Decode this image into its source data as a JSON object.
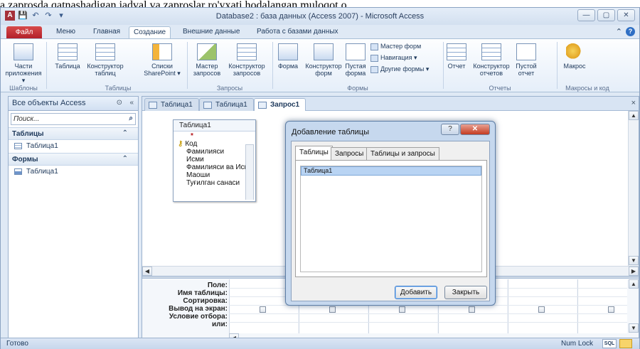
{
  "caption": "a zaprosda qatnashadigan jadval va zaproslar ro'yxati hodalangan muloqot o",
  "window": {
    "title": "Database2 : база данных (Access 2007) - Microsoft Access",
    "controls": [
      "—",
      "▢",
      "✕"
    ]
  },
  "qat": {
    "app_icon": "A",
    "save": "💾",
    "undo": "↶",
    "redo": "↷",
    "dropdown": "▾"
  },
  "ribbon_tabs": {
    "file": "Файл",
    "items": [
      "Меню",
      "Главная",
      "Создание",
      "Внешние данные",
      "Работа с базами данных"
    ]
  },
  "ribbon": {
    "templates": {
      "parts": "Части\nприложения ▾",
      "label": "Шаблоны"
    },
    "tables": {
      "table": "Таблица",
      "constructor": "Конструктор\nтаблиц",
      "lists": "Списки\nSharePoint ▾",
      "label": "Таблицы"
    },
    "queries": {
      "wizard": "Мастер\nзапросов",
      "constructor": "Конструктор\nзапросов",
      "label": "Запросы"
    },
    "forms": {
      "form": "Форма",
      "constructor": "Конструктор\nформ",
      "empty": "Пустая\nформа",
      "wizard": "Мастер форм",
      "navigation": "Навигация ▾",
      "other": "Другие формы ▾",
      "label": "Формы"
    },
    "reports": {
      "report": "Отчет",
      "constructor": "Конструктор\nотчетов",
      "empty": "Пустой\nотчет",
      "label": "Отчеты"
    },
    "macros": {
      "macro": "Макрос",
      "label": "Макросы и код"
    }
  },
  "nav": {
    "header": "Все объекты Access",
    "header_btn1": "⊙",
    "header_btn2": "«",
    "search_placeholder": "Поиск...",
    "search_icon": "⌕",
    "groups": [
      {
        "title": "Таблицы",
        "chevron": "⌃",
        "items": [
          "Таблица1"
        ]
      },
      {
        "title": "Формы",
        "chevron": "⌃",
        "items": [
          "Таблица1"
        ]
      }
    ]
  },
  "doc_tabs": [
    "Таблица1",
    "Таблица1",
    "Запрос1"
  ],
  "doc_close": "×",
  "table_box": {
    "title": "Таблица1",
    "star": "*",
    "key_symbol": "⚷",
    "fields": [
      "Код",
      "Фамилияси",
      "Исми",
      "Фамилияси ва Исми",
      "Маоши",
      "Туғилган санаси"
    ]
  },
  "grid": {
    "rows": [
      "Поле:",
      "Имя таблицы:",
      "Сортировка:",
      "Вывод на экран:",
      "Условие отбора:",
      "или:"
    ]
  },
  "dialog": {
    "title": "Добавление таблицы",
    "help_btn": "?",
    "close_btn": "✕",
    "tabs": [
      "Таблицы",
      "Запросы",
      "Таблицы и запросы"
    ],
    "list_items": [
      "Таблица1"
    ],
    "add_button": "Добавить",
    "close_button": "Закрыть"
  },
  "status": {
    "left": "Готово",
    "numlock": "Num Lock",
    "sql": "SQL"
  }
}
